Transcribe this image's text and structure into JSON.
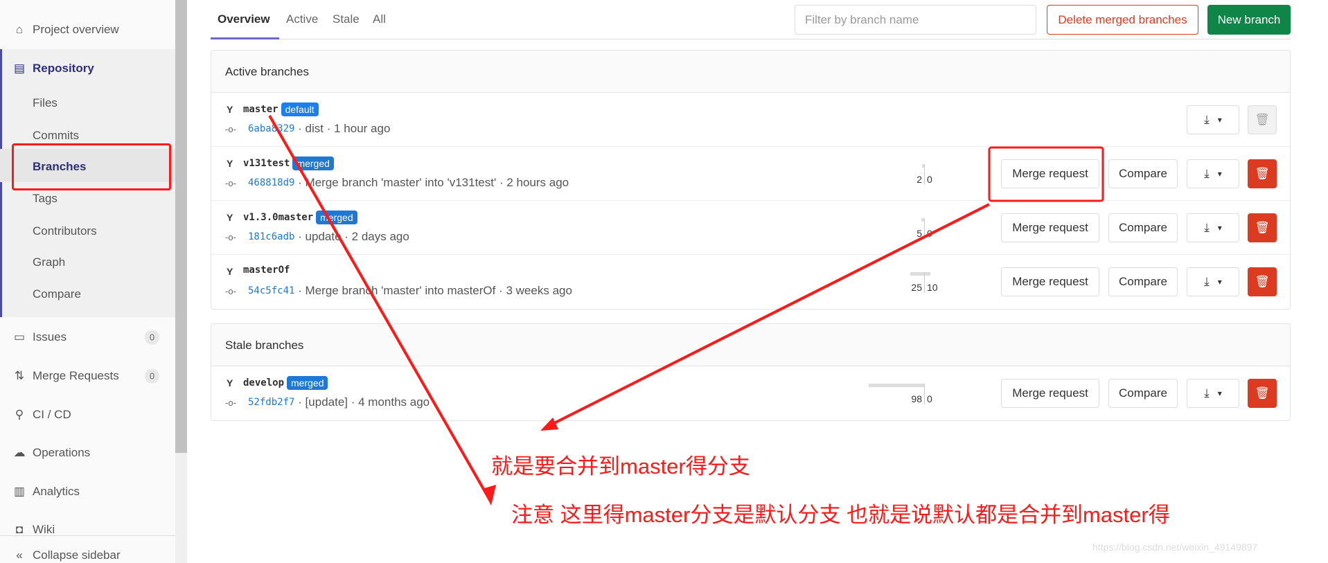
{
  "sidebar": {
    "project_overview": "Project overview",
    "repository": "Repository",
    "sub": [
      "Files",
      "Commits",
      "Branches",
      "Tags",
      "Contributors",
      "Graph",
      "Compare"
    ],
    "issues": "Issues",
    "issues_count": "0",
    "merge_requests": "Merge Requests",
    "mr_count": "0",
    "cicd": "CI / CD",
    "operations": "Operations",
    "analytics": "Analytics",
    "wiki": "Wiki",
    "collapse": "Collapse sidebar"
  },
  "tabs": [
    "Overview",
    "Active",
    "Stale",
    "All"
  ],
  "filter": {
    "placeholder": "Filter by branch name"
  },
  "buttons": {
    "delete_merged": "Delete merged branches",
    "new_branch": "New branch",
    "merge_request": "Merge request",
    "compare": "Compare"
  },
  "active": {
    "title": "Active branches",
    "rows": [
      {
        "name": "master",
        "badge": "default",
        "sha": "6aba8329",
        "msg": "· dist · 1 hour ago",
        "behind": null,
        "ahead": null
      },
      {
        "name": "v131test",
        "badge": "merged",
        "sha": "468818d9",
        "msg": "· Merge branch 'master' into 'v131test' · 2 hours ago",
        "behind": 2,
        "ahead": 0
      },
      {
        "name": "v1.3.0master",
        "badge": "merged",
        "sha": "181c6adb",
        "msg": "· update · 2 days ago",
        "behind": 5,
        "ahead": 0
      },
      {
        "name": "masterOf",
        "badge": "",
        "sha": "54c5fc41",
        "msg": "· Merge branch 'master' into masterOf · 3 weeks ago",
        "behind": 25,
        "ahead": 10
      }
    ]
  },
  "stale": {
    "title": "Stale branches",
    "rows": [
      {
        "name": "develop",
        "badge": "merged",
        "sha": "52fdb2f7",
        "msg": "· [update] · 4 months ago",
        "behind": 98,
        "ahead": 0
      }
    ]
  },
  "annotations": {
    "text1": "就是要合并到master得分支",
    "text2": "注意 这里得master分支是默认分支 也就是说默认都是合并到master得",
    "color": "#ff1a1a"
  },
  "watermark": "https://blog.csdn.net/weixin_49149897",
  "colors": {
    "accent": "#6b69c9",
    "danger": "#db3b21",
    "success": "#1aaa55",
    "badge": "#1f78d1"
  }
}
